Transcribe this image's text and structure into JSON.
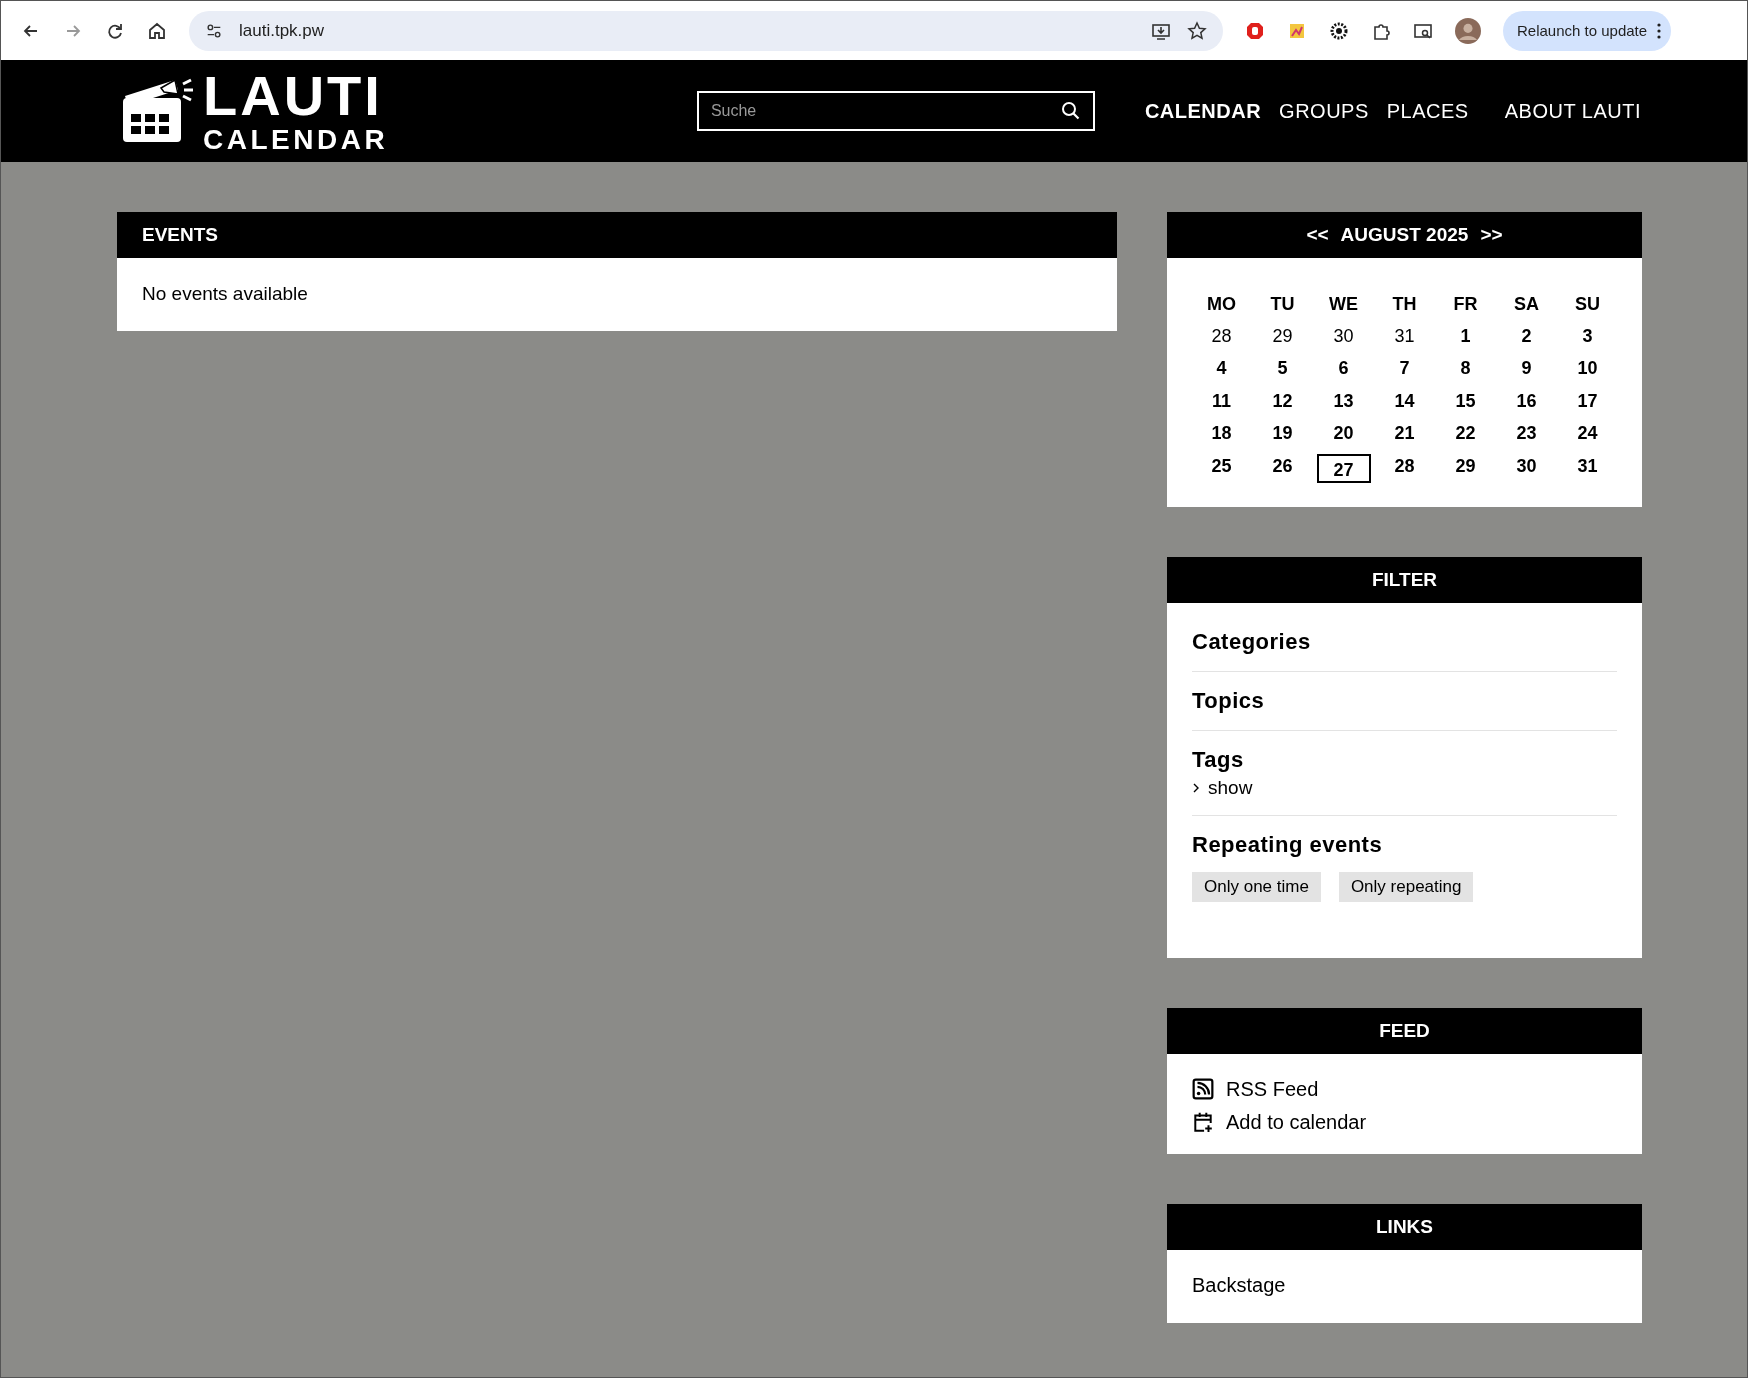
{
  "browser": {
    "url": "lauti.tpk.pw",
    "relaunch_button": "Relaunch to update"
  },
  "site": {
    "logo_title": "LAUTI",
    "logo_subtitle": "CALENDAR",
    "search": {
      "placeholder": "Suche"
    },
    "nav": [
      {
        "label": "CALENDAR",
        "selected": true
      },
      {
        "label": "GROUPS",
        "selected": false
      },
      {
        "label": "PLACES",
        "selected": false
      },
      {
        "label": "ABOUT LAUTI",
        "selected": false
      }
    ]
  },
  "events": {
    "title": "EVENTS",
    "empty_message": "No events available"
  },
  "calendar": {
    "prev": "<<",
    "month": "AUGUST 2025",
    "next": ">>",
    "weekdays": [
      "MO",
      "TU",
      "WE",
      "TH",
      "FR",
      "SA",
      "SU"
    ],
    "weeks": [
      [
        {
          "day": "28",
          "in_month": false,
          "today": false
        },
        {
          "day": "29",
          "in_month": false,
          "today": false
        },
        {
          "day": "30",
          "in_month": false,
          "today": false
        },
        {
          "day": "31",
          "in_month": false,
          "today": false
        },
        {
          "day": "1",
          "in_month": true,
          "today": false
        },
        {
          "day": "2",
          "in_month": true,
          "today": false
        },
        {
          "day": "3",
          "in_month": true,
          "today": false
        }
      ],
      [
        {
          "day": "4",
          "in_month": true,
          "today": false
        },
        {
          "day": "5",
          "in_month": true,
          "today": false
        },
        {
          "day": "6",
          "in_month": true,
          "today": false
        },
        {
          "day": "7",
          "in_month": true,
          "today": false
        },
        {
          "day": "8",
          "in_month": true,
          "today": false
        },
        {
          "day": "9",
          "in_month": true,
          "today": false
        },
        {
          "day": "10",
          "in_month": true,
          "today": false
        }
      ],
      [
        {
          "day": "11",
          "in_month": true,
          "today": false
        },
        {
          "day": "12",
          "in_month": true,
          "today": false
        },
        {
          "day": "13",
          "in_month": true,
          "today": false
        },
        {
          "day": "14",
          "in_month": true,
          "today": false
        },
        {
          "day": "15",
          "in_month": true,
          "today": false
        },
        {
          "day": "16",
          "in_month": true,
          "today": false
        },
        {
          "day": "17",
          "in_month": true,
          "today": false
        }
      ],
      [
        {
          "day": "18",
          "in_month": true,
          "today": false
        },
        {
          "day": "19",
          "in_month": true,
          "today": false
        },
        {
          "day": "20",
          "in_month": true,
          "today": false
        },
        {
          "day": "21",
          "in_month": true,
          "today": false
        },
        {
          "day": "22",
          "in_month": true,
          "today": false
        },
        {
          "day": "23",
          "in_month": true,
          "today": false
        },
        {
          "day": "24",
          "in_month": true,
          "today": false
        }
      ],
      [
        {
          "day": "25",
          "in_month": true,
          "today": false
        },
        {
          "day": "26",
          "in_month": true,
          "today": false
        },
        {
          "day": "27",
          "in_month": true,
          "today": true
        },
        {
          "day": "28",
          "in_month": true,
          "today": false
        },
        {
          "day": "29",
          "in_month": true,
          "today": false
        },
        {
          "day": "30",
          "in_month": true,
          "today": false
        },
        {
          "day": "31",
          "in_month": true,
          "today": false
        }
      ]
    ]
  },
  "filter": {
    "title": "FILTER",
    "sections": [
      {
        "kind": "heading",
        "title": "Categories"
      },
      {
        "kind": "heading",
        "title": "Topics"
      },
      {
        "kind": "toggle",
        "title": "Tags",
        "toggle": "show"
      },
      {
        "kind": "buttons",
        "title": "Repeating events",
        "buttons": [
          "Only one time",
          "Only repeating"
        ]
      }
    ]
  },
  "feed": {
    "title": "FEED",
    "items": [
      {
        "kind": "rss",
        "label": "RSS Feed"
      },
      {
        "kind": "calendar",
        "label": "Add to calendar"
      }
    ]
  },
  "links": {
    "title": "LINKS",
    "items": [
      "Backstage"
    ]
  }
}
